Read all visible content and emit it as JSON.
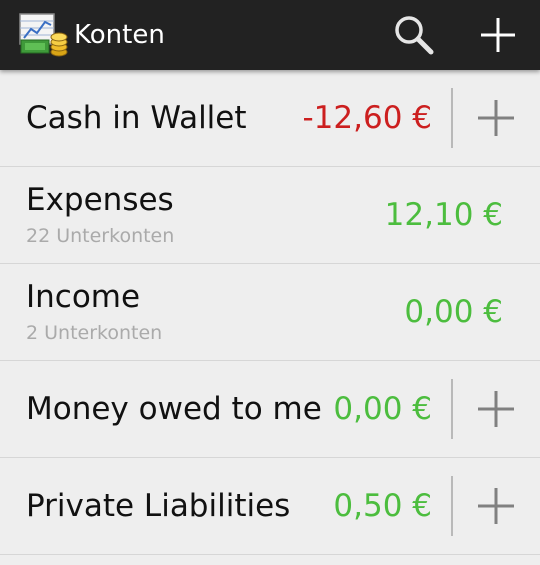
{
  "actionbar": {
    "title": "Konten",
    "app_icon": "money-ledger-icon",
    "search_icon": "search-icon",
    "add_icon": "plus-icon"
  },
  "accounts": [
    {
      "name": "Cash in Wallet",
      "subtitle": "",
      "balance": "-12,60 €",
      "balance_color": "#cc1f1f",
      "has_add": true
    },
    {
      "name": "Expenses",
      "subtitle": "22 Unterkonten",
      "balance": "12,10 €",
      "balance_color": "#4cbd3e",
      "has_add": false
    },
    {
      "name": "Income",
      "subtitle": "2 Unterkonten",
      "balance": "0,00 €",
      "balance_color": "#4cbd3e",
      "has_add": false
    },
    {
      "name": "Money owed to me",
      "subtitle": "",
      "balance": "0,00 €",
      "balance_color": "#4cbd3e",
      "has_add": true
    },
    {
      "name": "Private Liabilities",
      "subtitle": "",
      "balance": "0,50 €",
      "balance_color": "#4cbd3e",
      "has_add": true
    }
  ],
  "colors": {
    "actionbar_bg": "#222222",
    "list_bg": "#eeeeee",
    "negative": "#cc1f1f",
    "positive": "#4cbd3e"
  }
}
